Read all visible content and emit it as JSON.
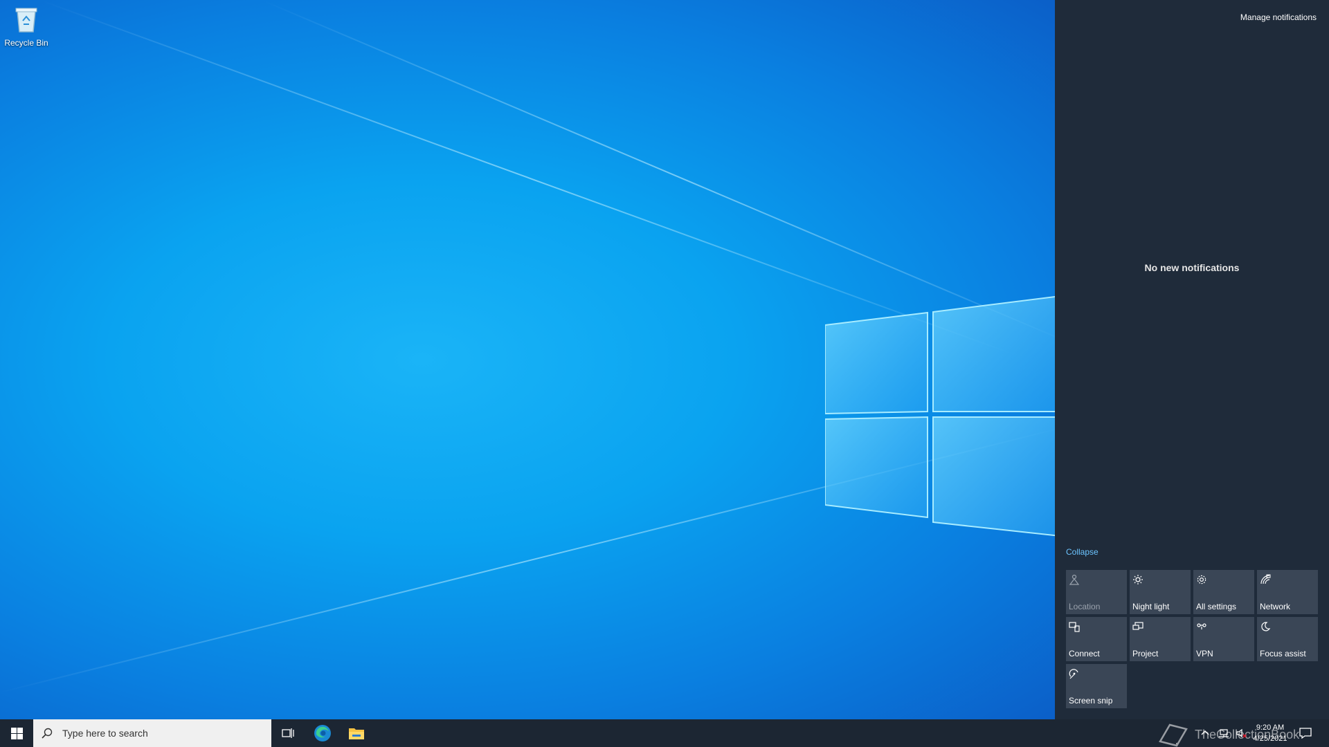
{
  "desktop": {
    "recycle_bin_label": "Recycle Bin"
  },
  "action_center": {
    "manage_notifications": "Manage notifications",
    "no_notifications": "No new notifications",
    "collapse_label": "Collapse",
    "tiles": [
      {
        "label": "Location",
        "icon": "location-icon",
        "enabled": false
      },
      {
        "label": "Night light",
        "icon": "night-light-icon",
        "enabled": true
      },
      {
        "label": "All settings",
        "icon": "gear-icon",
        "enabled": true
      },
      {
        "label": "Network",
        "icon": "network-icon",
        "enabled": true
      },
      {
        "label": "Connect",
        "icon": "connect-icon",
        "enabled": true
      },
      {
        "label": "Project",
        "icon": "project-icon",
        "enabled": true
      },
      {
        "label": "VPN",
        "icon": "vpn-icon",
        "enabled": true
      },
      {
        "label": "Focus assist",
        "icon": "moon-icon",
        "enabled": true
      },
      {
        "label": "Screen snip",
        "icon": "screen-snip-icon",
        "enabled": true
      }
    ]
  },
  "taskbar": {
    "search_placeholder": "Type here to search",
    "clock_time": "9:20 AM",
    "clock_date": "4/25/2021",
    "watermark_text": "TheCollectionBook"
  },
  "colors": {
    "action_center_bg": "#1f2b3a",
    "tile_bg": "#3a4656",
    "accent_link": "#6cc4ff",
    "taskbar_bg": "#1c2633"
  }
}
